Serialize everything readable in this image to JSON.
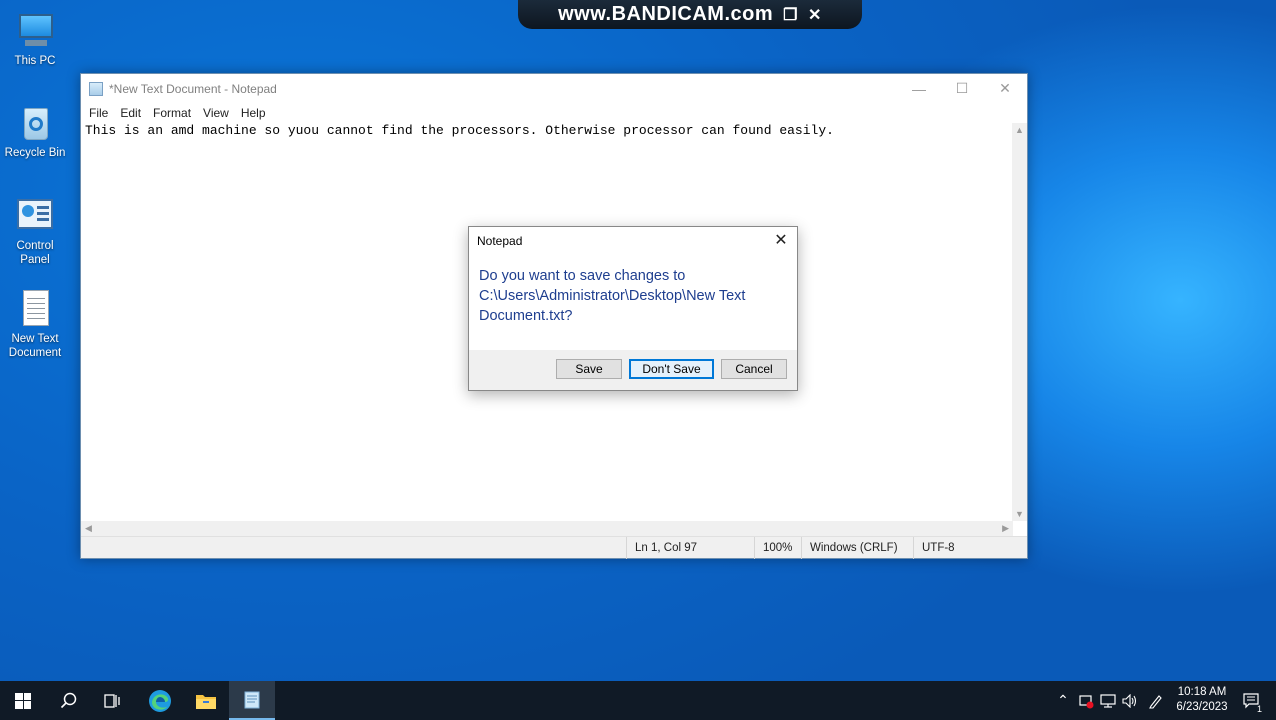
{
  "watermark": {
    "text": "www.BANDICAM.com",
    "restore_icon": "❐",
    "close_icon": "✕"
  },
  "desktop": {
    "icons": [
      {
        "label": "This PC"
      },
      {
        "label": "Recycle Bin"
      },
      {
        "label": "Control Panel"
      },
      {
        "label": "New Text Document"
      }
    ]
  },
  "notepad": {
    "title": "*New Text Document - Notepad",
    "controls": {
      "minimize": "—",
      "maximize": "☐",
      "close": "✕"
    },
    "menu": [
      "File",
      "Edit",
      "Format",
      "View",
      "Help"
    ],
    "content": "This is an amd machine so yuou cannot find the processors. Otherwise processor can found easily.",
    "status": {
      "position": "Ln 1, Col 97",
      "zoom": "100%",
      "line_ending": "Windows (CRLF)",
      "encoding": "UTF-8"
    }
  },
  "dialog": {
    "title": "Notepad",
    "message": "Do you want to save changes to C:\\Users\\Administrator\\Desktop\\New Text Document.txt?",
    "buttons": {
      "save": "Save",
      "dont_save": "Don't Save",
      "cancel": "Cancel"
    },
    "default_button": "dont_save"
  },
  "taskbar": {
    "clock": {
      "time": "10:18 AM",
      "date": "6/23/2023"
    },
    "notification_count": "1",
    "colors": {
      "bar": "#101a26",
      "active_underline": "#76b9ed"
    }
  }
}
